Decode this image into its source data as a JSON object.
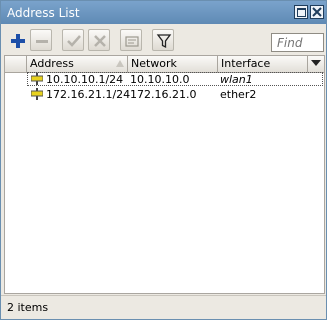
{
  "window": {
    "title": "Address List"
  },
  "toolbar": {
    "add": "plus-icon",
    "remove": "minus-icon",
    "enable": "check-icon",
    "disable": "cross-icon",
    "comment": "comment-icon",
    "filter": "filter-icon",
    "find_placeholder": "Find"
  },
  "table": {
    "columns": [
      "Address",
      "Network",
      "Interface"
    ],
    "rows": [
      {
        "address": "10.10.10.1/24",
        "network": "10.10.10.0",
        "interface": "wlan1"
      },
      {
        "address": "172.16.21.1/24",
        "network": "172.16.21.0",
        "interface": "ether2"
      }
    ]
  },
  "status": {
    "items": "2 items"
  },
  "colors": {
    "titlebar": "#6a94c0",
    "add_icon": "#1d4fa8",
    "address_icon": "#d8c21a"
  }
}
